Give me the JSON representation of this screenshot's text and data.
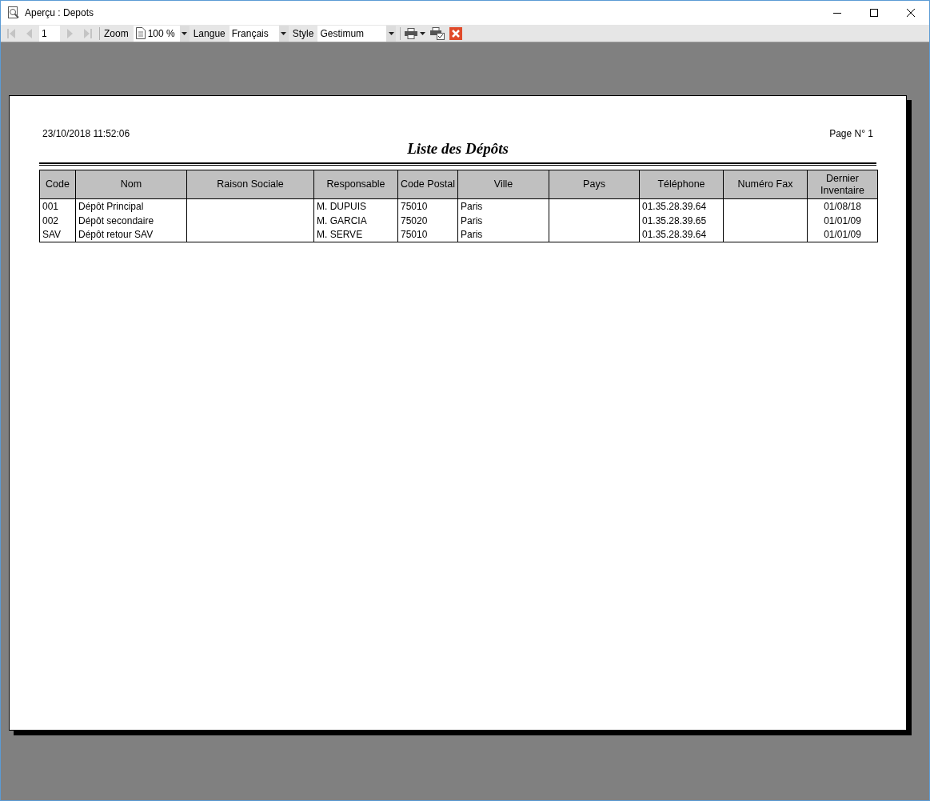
{
  "window": {
    "title": "Aperçu : Depots"
  },
  "toolbar": {
    "nav_buttons": [
      {
        "kind": "first",
        "disabled": true
      },
      {
        "kind": "prev",
        "disabled": true
      },
      {
        "kind": "page",
        "value": "1"
      },
      {
        "kind": "next",
        "disabled": true
      },
      {
        "kind": "last",
        "disabled": true
      }
    ],
    "zoom_label": "Zoom",
    "zoom_value": "100 %",
    "language_label": "Langue",
    "language_value": "Français",
    "style_label": "Style",
    "style_value": "Gestimum"
  },
  "report": {
    "date": "23/10/2018 11:52:06",
    "page": "Page N° 1",
    "title": "Liste des Dépôts",
    "columns": [
      {
        "label": "Code",
        "kind": "text"
      },
      {
        "label": "Nom",
        "kind": "text"
      },
      {
        "label": "Raison Sociale",
        "kind": "text"
      },
      {
        "label": "Responsable",
        "kind": "text"
      },
      {
        "label": "Code Postal",
        "kind": "text"
      },
      {
        "label": "Ville",
        "kind": "text"
      },
      {
        "label": "Pays",
        "kind": "text"
      },
      {
        "label": "Téléphone",
        "kind": "text"
      },
      {
        "label": "Numéro Fax",
        "kind": "text"
      },
      {
        "label": "Dernier Inventaire",
        "kind": "date"
      }
    ],
    "rows": [
      {
        "cells": [
          "001",
          "Dépôt Principal",
          null,
          "M. DUPUIS",
          "75010",
          "Paris",
          null,
          "01.35.28.39.64",
          null,
          "01/08/18"
        ]
      },
      {
        "cells": [
          "002",
          "Dépôt secondaire",
          null,
          "M. GARCIA",
          "75020",
          "Paris",
          null,
          "01.35.28.39.65",
          null,
          "01/01/09"
        ]
      },
      {
        "cells": [
          "SAV",
          "Dépôt retour SAV",
          null,
          "M. SERVE",
          "75010",
          "Paris",
          null,
          "01.35.28.39.64",
          null,
          "01/01/09"
        ]
      }
    ]
  }
}
